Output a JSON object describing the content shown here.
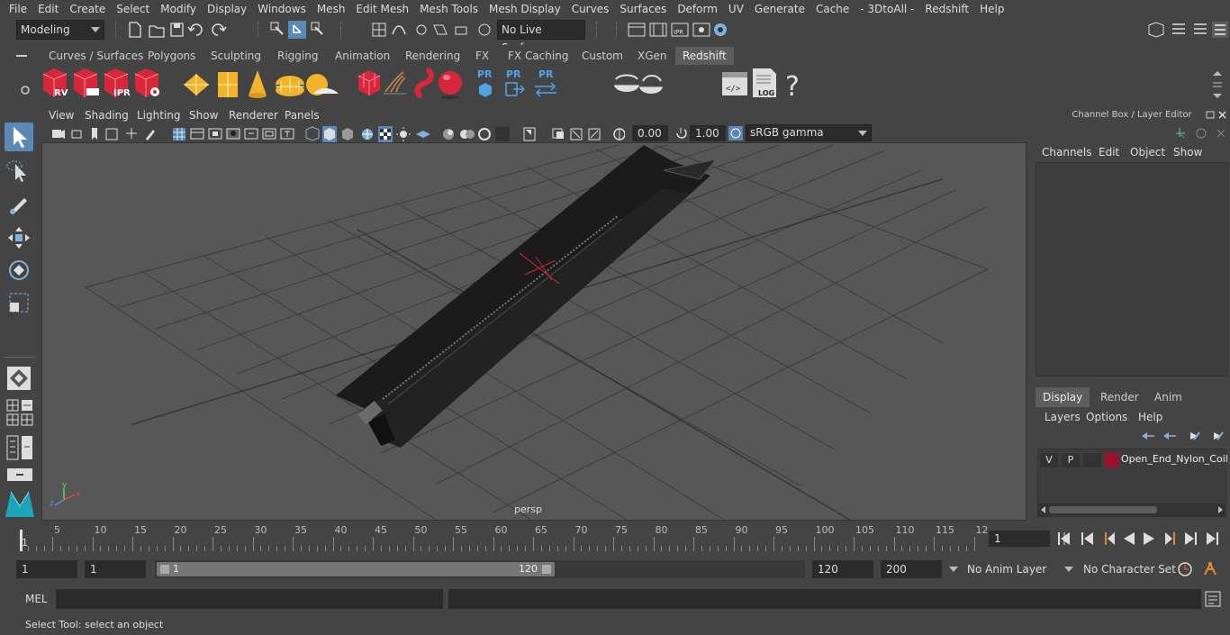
{
  "menubar": [
    "File",
    "Edit",
    "Create",
    "Select",
    "Modify",
    "Display",
    "Windows",
    "Mesh",
    "Edit Mesh",
    "Mesh Tools",
    "Mesh Display",
    "Curves",
    "Surfaces",
    "Deform",
    "UV",
    "Generate",
    "Cache",
    "- 3DtoAll -",
    "Redshift",
    "Help"
  ],
  "status": {
    "mode": "Modeling",
    "live_surface": "No Live Surface"
  },
  "shelf_tabs": [
    "Curves / Surfaces",
    "Polygons",
    "Sculpting",
    "Rigging",
    "Animation",
    "Rendering",
    "FX",
    "FX Caching",
    "Custom",
    "XGen",
    "Redshift"
  ],
  "shelf_active": "Redshift",
  "shelf_labels": {
    "rv": "RV",
    "ipr": "IPR",
    "pr1": "PR",
    "pr2": "PR",
    "pr3": "PR",
    "log": "LOG",
    "help": "?"
  },
  "view_menu": [
    "View",
    "Shading",
    "Lighting",
    "Show",
    "Renderer",
    "Panels"
  ],
  "view_tools": {
    "exposure": "0.00",
    "gamma": "1.00",
    "colorspace": "sRGB gamma"
  },
  "viewport": {
    "camera": "persp",
    "axis_y": "y",
    "axis_x": "x",
    "axis_z": "z"
  },
  "channel_box": {
    "title": "Channel Box / Layer Editor",
    "menus": [
      "Channels",
      "Edit",
      "Object",
      "Show"
    ]
  },
  "layer_editor": {
    "tabs": [
      "Display",
      "Render",
      "Anim"
    ],
    "active_tab": "Display",
    "menus": [
      "Layers",
      "Options",
      "Help"
    ],
    "layer": {
      "v": "V",
      "p": "P",
      "name": "Open_End_Nylon_Coil",
      "color": "#a0102a"
    }
  },
  "timeline": {
    "ticks": [
      "5",
      "10",
      "15",
      "20",
      "25",
      "30",
      "35",
      "40",
      "45",
      "50",
      "55",
      "60",
      "65",
      "70",
      "75",
      "80",
      "85",
      "90",
      "95",
      "100",
      "105",
      "110",
      "115",
      "12"
    ],
    "start_marker": "1",
    "current_frame": "1"
  },
  "range": {
    "start": "1",
    "playback_start": "1",
    "slider_start": "1",
    "slider_end": "120",
    "playback_end": "120",
    "end": "200",
    "anim_layer": "No Anim Layer",
    "character_set": "No Character Set"
  },
  "command": {
    "lang": "MEL"
  },
  "help_line": "Select Tool: select an object",
  "colors": {
    "bg": "#444444",
    "viewport": "#575757",
    "active_tool": "#5c88b8",
    "redshift_red": "#d8263a"
  }
}
